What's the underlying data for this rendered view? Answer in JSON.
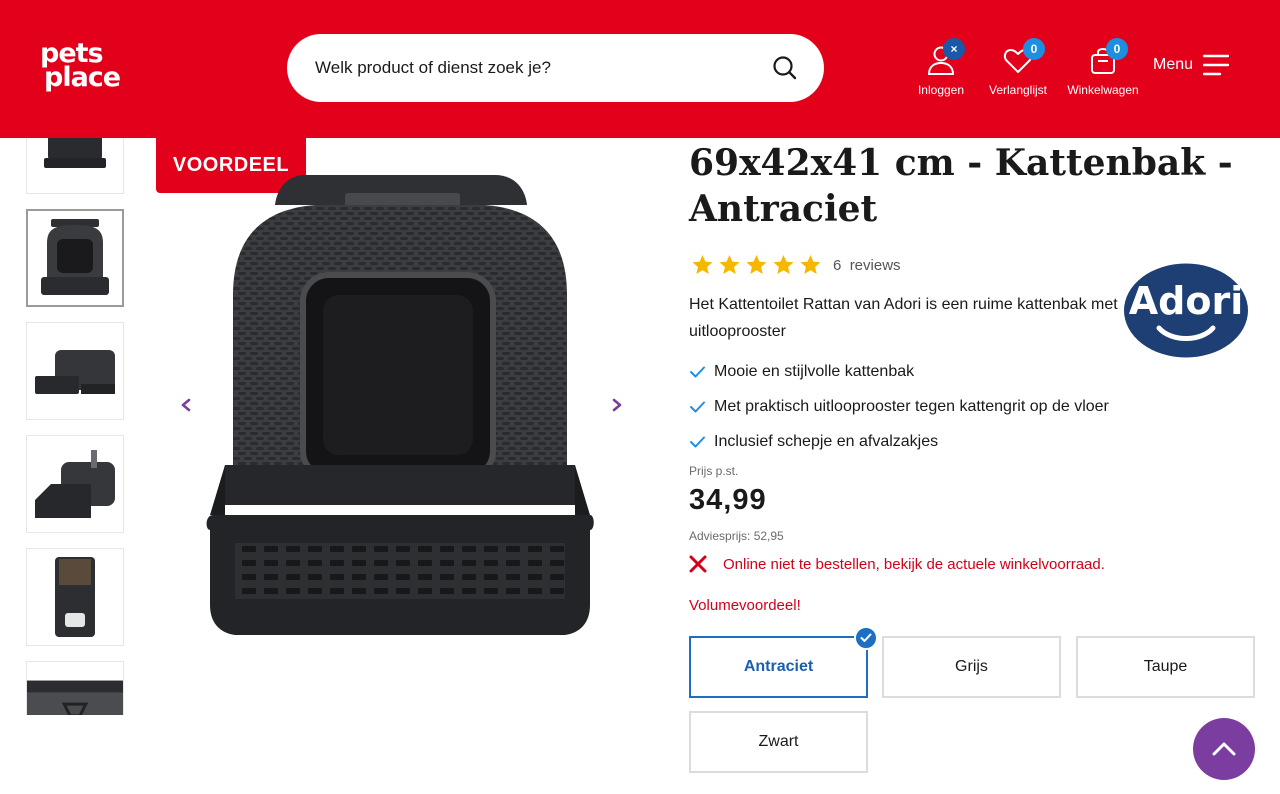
{
  "header": {
    "logo_line1": "pets",
    "logo_line2": "place",
    "search_placeholder": "Welk product of dienst zoek je?",
    "nav": {
      "login_label": "Inloggen",
      "wishlist_label": "Verlanglijst",
      "wishlist_count": "0",
      "cart_label": "Winkelwagen",
      "cart_count": "0",
      "login_badge": "×",
      "menu_label": "Menu"
    },
    "brand_color": "#e3001b"
  },
  "gallery": {
    "promo_label": "VOORDEEL",
    "thumbnail_count": 6,
    "active_thumbnail": 2
  },
  "product": {
    "title": "69x42x41 cm - Kattenbak - Antraciet",
    "rating": 5,
    "reviews_count": "6",
    "reviews_label": "reviews",
    "brand_logo_text": "Adori",
    "description": "Het Kattentoilet Rattan van Adori is een ruime kattenbak met uitlooprooster",
    "usps": [
      "Mooie en stijlvolle kattenbak",
      "Met praktisch uitlooprooster tegen kattengrit op de vloer",
      "Inclusief schepje en afvalzakjes"
    ],
    "price_label": "Prijs p.st.",
    "price": "34,99",
    "advice_price": "Adviesprijs: 52,95",
    "stock_message": "Online niet te bestellen, bekijk de actuele winkelvoorraad.",
    "volume_discount": "Volumevoordeel!",
    "variants": [
      "Antraciet",
      "Grijs",
      "Taupe",
      "Zwart"
    ],
    "selected_variant": "Antraciet",
    "accent_colors": {
      "star": "#f5b800",
      "check": "#1e8fe0",
      "error": "#d4001a",
      "scroll": "#7b3ea0"
    }
  }
}
